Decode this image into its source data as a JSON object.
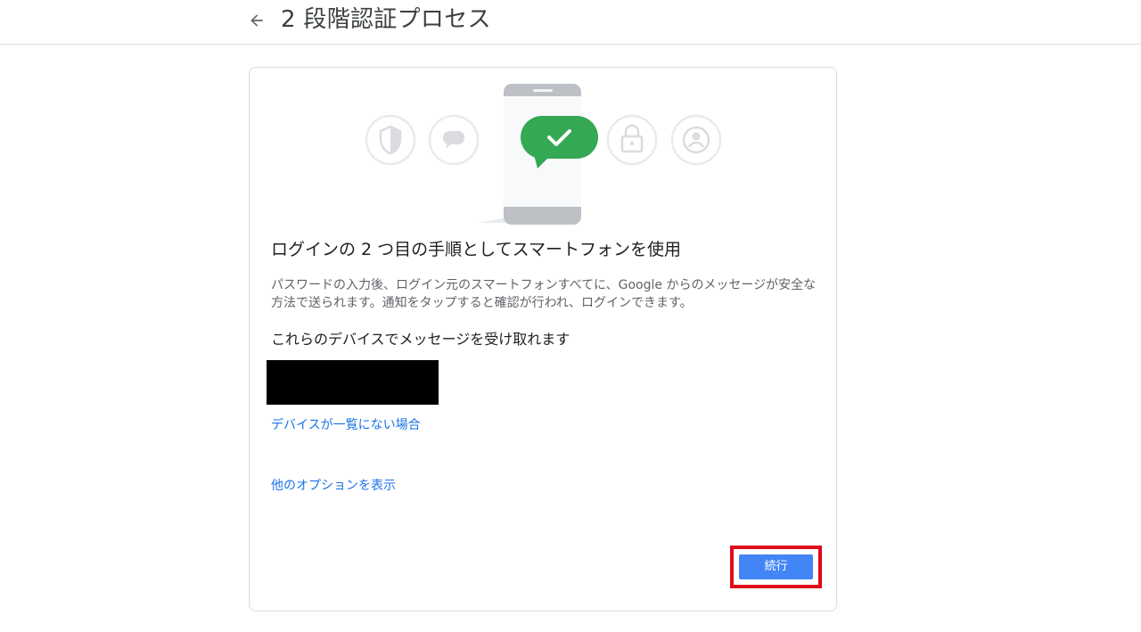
{
  "header": {
    "title": "2 段階認証プロセス",
    "back_icon": "arrow-back-icon"
  },
  "card": {
    "illustration_icons": [
      "shield-icon",
      "chat-icon",
      "phone-icon",
      "check-bubble-icon",
      "lock-icon",
      "account-icon"
    ],
    "heading": "ログインの 2 つ目の手順としてスマートフォンを使用",
    "description": "パスワードの入力後、ログイン元のスマートフォンすべてに、Google からのメッセージが安全な方法で送られます。通知をタップすると確認が行われ、ログインできます。",
    "devices_heading": "これらのデバイスでメッセージを受け取れます",
    "device_missing_link": "デバイスが一覧にない場合",
    "more_options_link": "他のオプションを表示",
    "continue_label": "続行"
  },
  "colors": {
    "link": "#1a73e8",
    "primary_button": "#4285f4",
    "highlight": "#e00a1a",
    "success_bubble": "#34a853"
  }
}
